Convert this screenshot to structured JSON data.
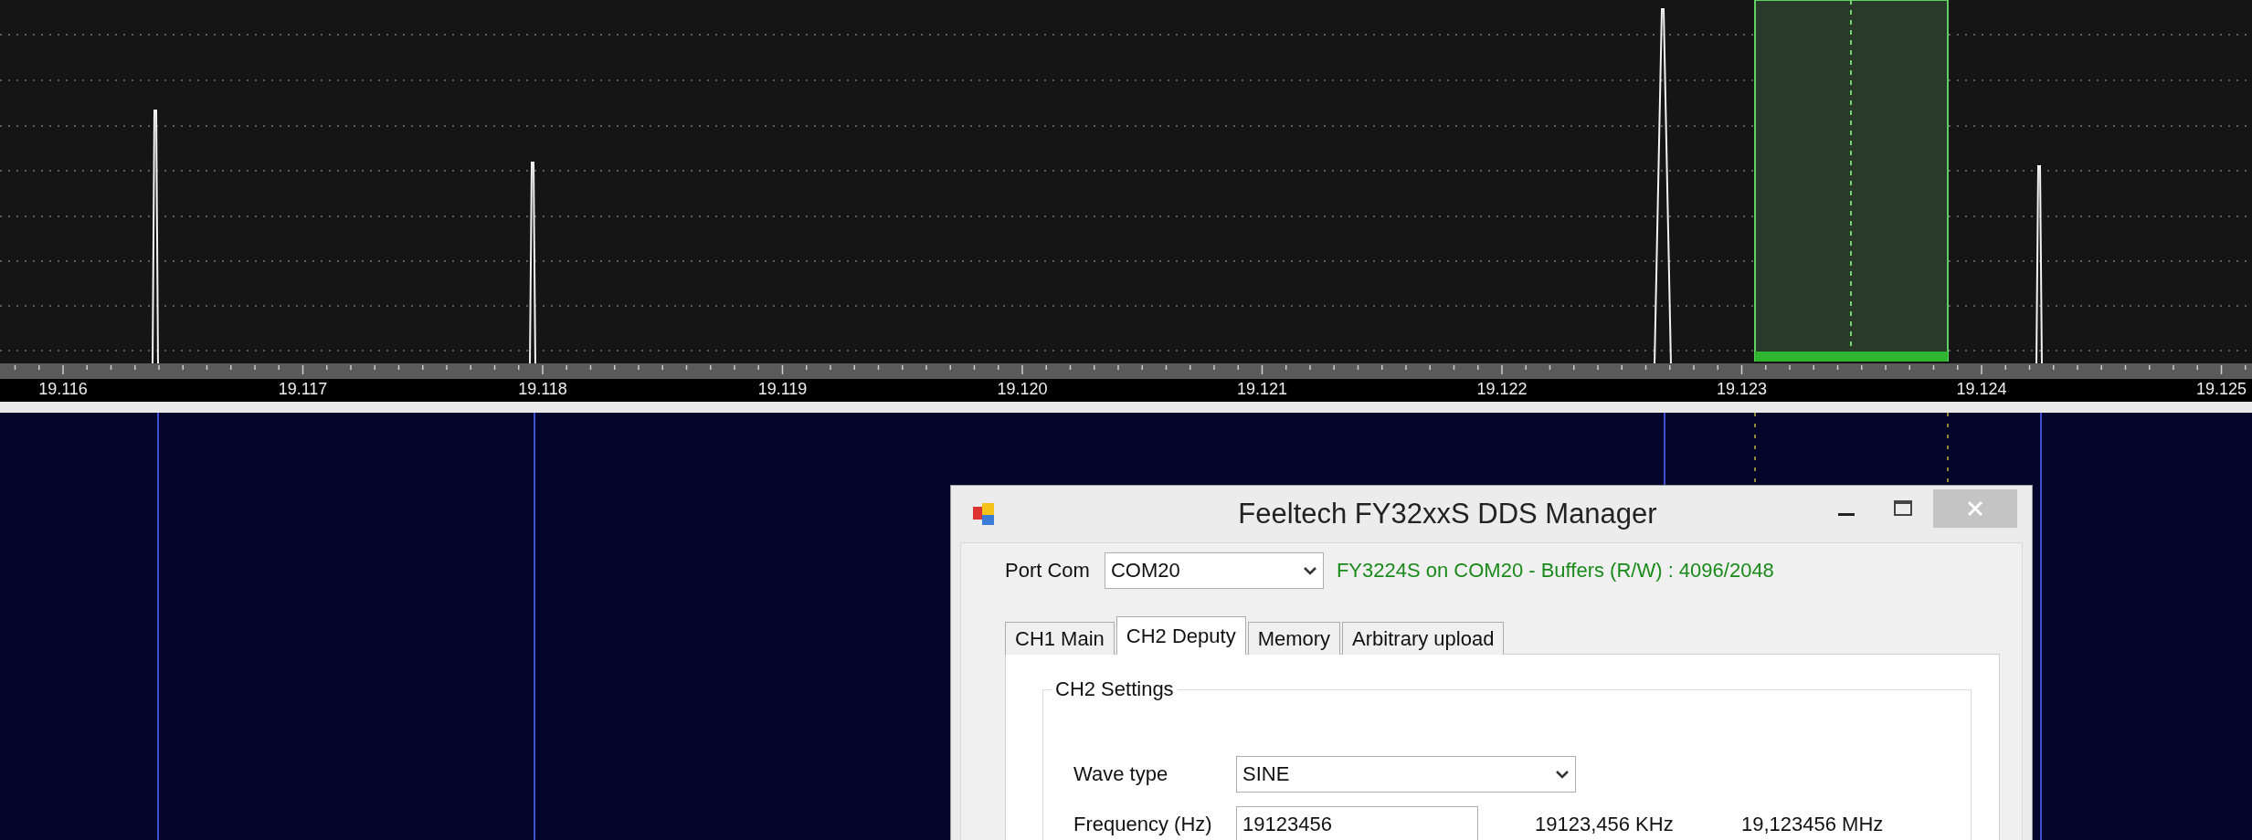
{
  "spectrum": {
    "frequency_labels": [
      "19.116",
      "19.117",
      "19.118",
      "19.119",
      "19.120",
      "19.121",
      "19.122",
      "19.123",
      "19.124",
      "19.125"
    ]
  },
  "dialog": {
    "title": "Feeltech FY32xxS DDS Manager",
    "port": {
      "label": "Port Com",
      "value": "COM20"
    },
    "status": "FY3224S on COM20 - Buffers (R/W) : 4096/2048",
    "tabs": [
      {
        "label": "CH1 Main",
        "selected": false
      },
      {
        "label": "CH2 Deputy",
        "selected": true
      },
      {
        "label": "Memory",
        "selected": false
      },
      {
        "label": "Arbitrary upload",
        "selected": false
      }
    ],
    "group_title": "CH2 Settings",
    "fields": [
      {
        "label": "Wave type",
        "kind": "dropdown",
        "value": "SINE"
      },
      {
        "label": "Frequency (Hz)",
        "kind": "text",
        "value": "19123456",
        "readouts": [
          "19123,456 KHz",
          "19,123456 MHz"
        ]
      }
    ]
  }
}
